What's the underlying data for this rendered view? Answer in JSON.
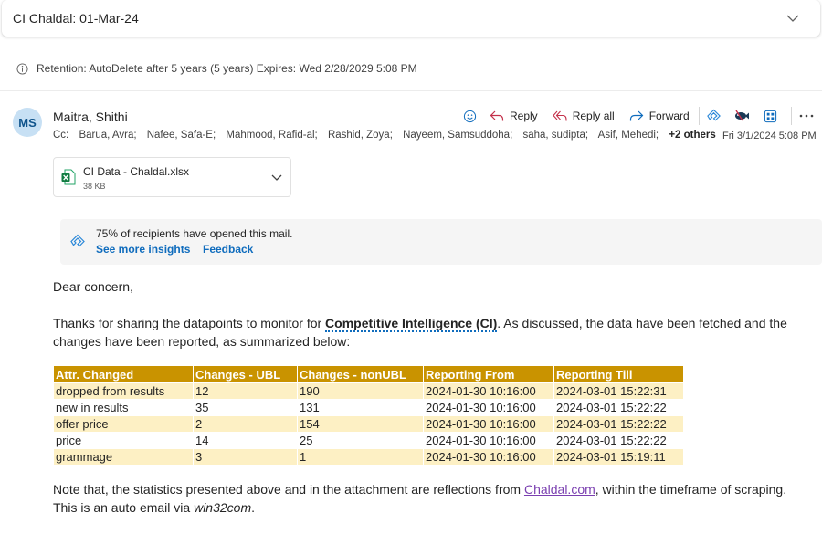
{
  "subject": "CI Chaldal: 01-Mar-24",
  "retention": "Retention: AutoDelete after 5 years (5 years) Expires: Wed 2/28/2029 5:08 PM",
  "sender": {
    "initials": "MS",
    "name": "Maitra, Shithi"
  },
  "actions": {
    "reply": "Reply",
    "reply_all": "Reply all",
    "forward": "Forward"
  },
  "cc": {
    "label": "Cc:",
    "recipients": [
      "Barua, Avra;",
      "Nafee, Safa-E;",
      "Mahmood, Rafid-al;",
      "Rashid, Zoya;",
      "Nayeem, Samsuddoha;",
      "saha, sudipta;",
      "Asif, Mehedi;"
    ],
    "more": "+2 others"
  },
  "timestamp": "Fri 3/1/2024 5:08 PM",
  "attachment": {
    "name": "CI Data - Chaldal.xlsx",
    "size": "38 KB"
  },
  "insights": {
    "text": "75% of recipients have opened this mail.",
    "see_more": "See more insights",
    "feedback": "Feedback"
  },
  "body": {
    "greeting": "Dear concern,",
    "p2_before": "Thanks for sharing the datapoints to monitor for ",
    "p2_term": "Competitive Intelligence (CI)",
    "p2_after": ". As discussed, the data have been fetched and the changes have been reported, as summarized below:",
    "p3_before": "Note that, the statistics presented above and in the attachment are reflections from ",
    "p3_link": "Chaldal.com",
    "p3_middle": ", within the timeframe of scraping. This is an auto email via ",
    "p3_italic": "win32com",
    "p3_end": "."
  },
  "table": {
    "headers": [
      "Attr. Changed",
      "Changes - UBL",
      "Changes - nonUBL",
      "Reporting From",
      "Reporting Till"
    ],
    "rows": [
      [
        "dropped from results",
        "12",
        "190",
        "2024-01-30 10:16:00",
        "2024-03-01 15:22:31"
      ],
      [
        "new in results",
        "35",
        "131",
        "2024-01-30 10:16:00",
        "2024-03-01 15:22:22"
      ],
      [
        "offer price",
        "2",
        "154",
        "2024-01-30 10:16:00",
        "2024-03-01 15:22:22"
      ],
      [
        "price",
        "14",
        "25",
        "2024-01-30 10:16:00",
        "2024-03-01 15:22:22"
      ],
      [
        "grammage",
        "3",
        "1",
        "2024-01-30 10:16:00",
        "2024-03-01 15:19:11"
      ]
    ]
  },
  "colors": {
    "accent": "#0f6cbd",
    "table_header": "#c99300",
    "table_band": "#fdf0c4",
    "avatar_bg": "#c7e0f4"
  }
}
